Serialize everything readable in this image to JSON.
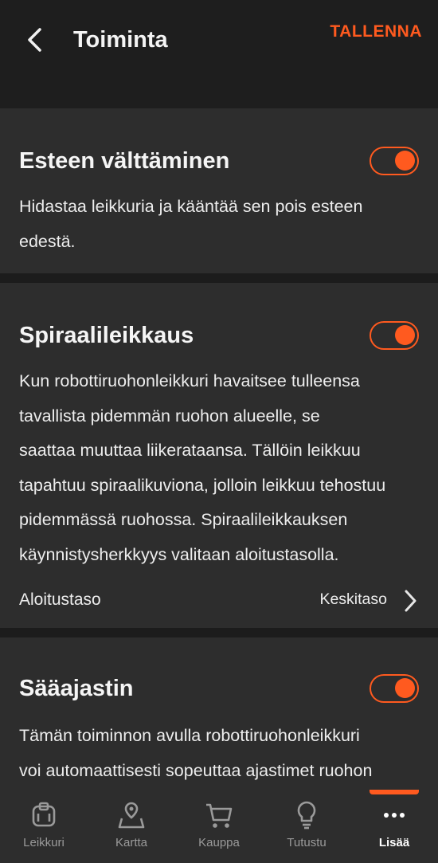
{
  "header": {
    "title": "Toiminta",
    "save_label": "TALLENNA"
  },
  "cards": [
    {
      "title": "Esteen välttäminen",
      "toggle_on": true,
      "description_lines": [
        "Hidastaa leikkuria ja kääntää sen pois esteen",
        "edestä."
      ]
    },
    {
      "title": "Spiraalileikkaus",
      "toggle_on": true,
      "description_lines": [
        "Kun robottiruohonleikkuri havaitsee tulleensa",
        "tavallista pidemmän ruohon alueelle, se",
        "saattaa muuttaa liikerataansa. Tällöin leikkuu",
        "tapahtuu spiraalikuviona, jolloin leikkuu tehostuu",
        "pidemmässä ruohossa. Spiraalileikkauksen",
        "käynnistysherkkyys valitaan aloitustasolla."
      ],
      "setting": {
        "label": "Aloitustaso",
        "value": "Keskitaso"
      }
    },
    {
      "title": "Sääajastin",
      "toggle_on": true,
      "description_lines": [
        "Tämän toiminnon avulla robottiruohonleikkuri",
        "voi automaattisesti sopeuttaa ajastimet ruohon"
      ]
    }
  ],
  "nav": {
    "items": [
      {
        "label": "Leikkuri",
        "icon": "mower-icon"
      },
      {
        "label": "Kartta",
        "icon": "map-pin-icon"
      },
      {
        "label": "Kauppa",
        "icon": "cart-icon"
      },
      {
        "label": "Tutustu",
        "icon": "lightbulb-icon"
      },
      {
        "label": "Lisää",
        "icon": "more-icon"
      }
    ],
    "active_index": 4
  },
  "colors": {
    "accent": "#ff5a1f",
    "background": "#1c1c1c",
    "card": "#2d2d2d"
  }
}
